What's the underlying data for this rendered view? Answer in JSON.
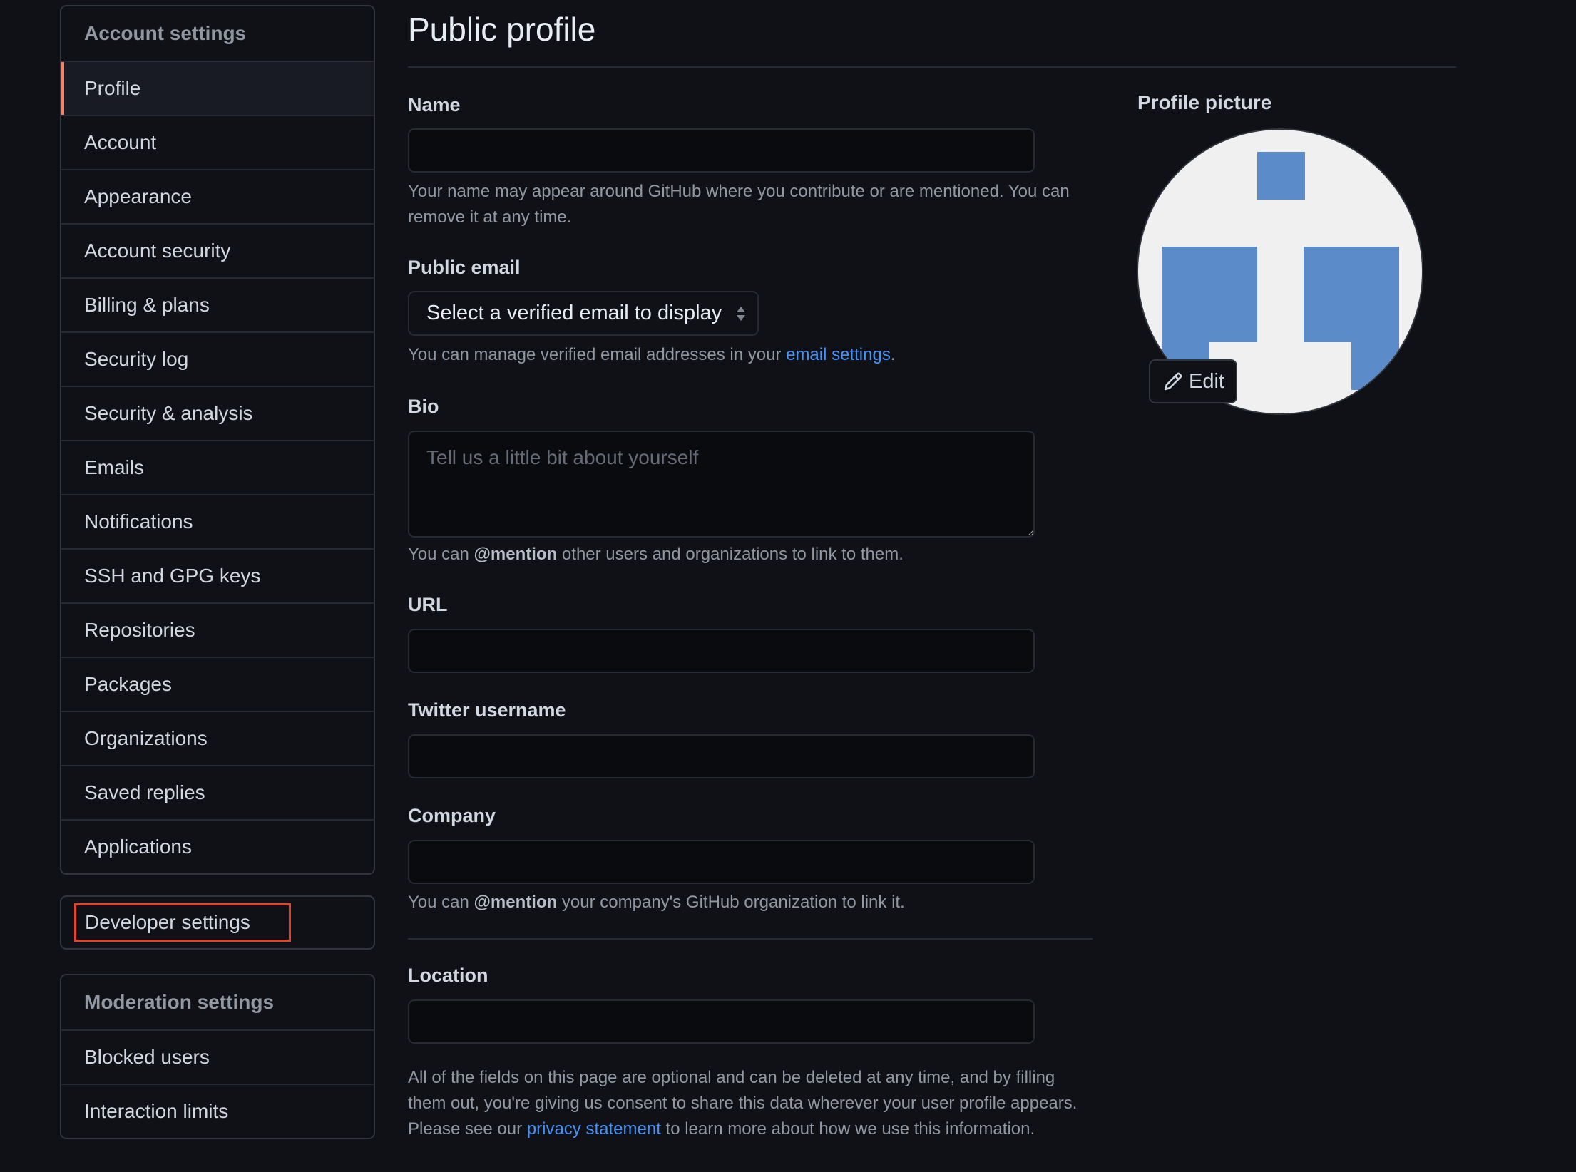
{
  "sidebar": {
    "account_settings_header": "Account settings",
    "items": [
      {
        "label": "Profile",
        "active": true
      },
      {
        "label": "Account"
      },
      {
        "label": "Appearance"
      },
      {
        "label": "Account security"
      },
      {
        "label": "Billing & plans"
      },
      {
        "label": "Security log"
      },
      {
        "label": "Security & analysis"
      },
      {
        "label": "Emails"
      },
      {
        "label": "Notifications"
      },
      {
        "label": "SSH and GPG keys"
      },
      {
        "label": "Repositories"
      },
      {
        "label": "Packages"
      },
      {
        "label": "Organizations"
      },
      {
        "label": "Saved replies"
      },
      {
        "label": "Applications"
      }
    ],
    "developer_settings": "Developer settings",
    "moderation_header": "Moderation settings",
    "moderation_items": [
      {
        "label": "Blocked users"
      },
      {
        "label": "Interaction limits"
      }
    ],
    "active_accent": "#f78166",
    "highlight_box_color": "#e5432a"
  },
  "main": {
    "title": "Public profile",
    "name": {
      "label": "Name",
      "value": "",
      "note": "Your name may appear around GitHub where you contribute or are mentioned. You can remove it at any time."
    },
    "public_email": {
      "label": "Public email",
      "selected": "Select a verified email to display",
      "note_prefix": "You can manage verified email addresses in your ",
      "note_link": "email settings",
      "note_suffix": "."
    },
    "bio": {
      "label": "Bio",
      "value": "",
      "placeholder": "Tell us a little bit about yourself",
      "note_prefix": "You can ",
      "note_bold": "@mention",
      "note_suffix": " other users and organizations to link to them."
    },
    "url": {
      "label": "URL",
      "value": ""
    },
    "twitter": {
      "label": "Twitter username",
      "value": ""
    },
    "company": {
      "label": "Company",
      "value": "",
      "note_prefix": "You can ",
      "note_bold": "@mention",
      "note_suffix": " your company's GitHub organization to link it."
    },
    "location": {
      "label": "Location",
      "value": ""
    },
    "footer": {
      "prefix": "All of the fields on this page are optional and can be deleted at any time, and by filling them out, you're giving us consent to share this data wherever your user profile appears. Please see our ",
      "link": "privacy statement",
      "suffix": " to learn more about how we use this information."
    },
    "link_color": "#4493f8"
  },
  "profile_picture": {
    "label": "Profile picture",
    "edit_label": "Edit",
    "edit_icon": "pencil-icon",
    "identicon_color": "#5b8bc9",
    "identicon_bg": "#f0f0f0"
  }
}
